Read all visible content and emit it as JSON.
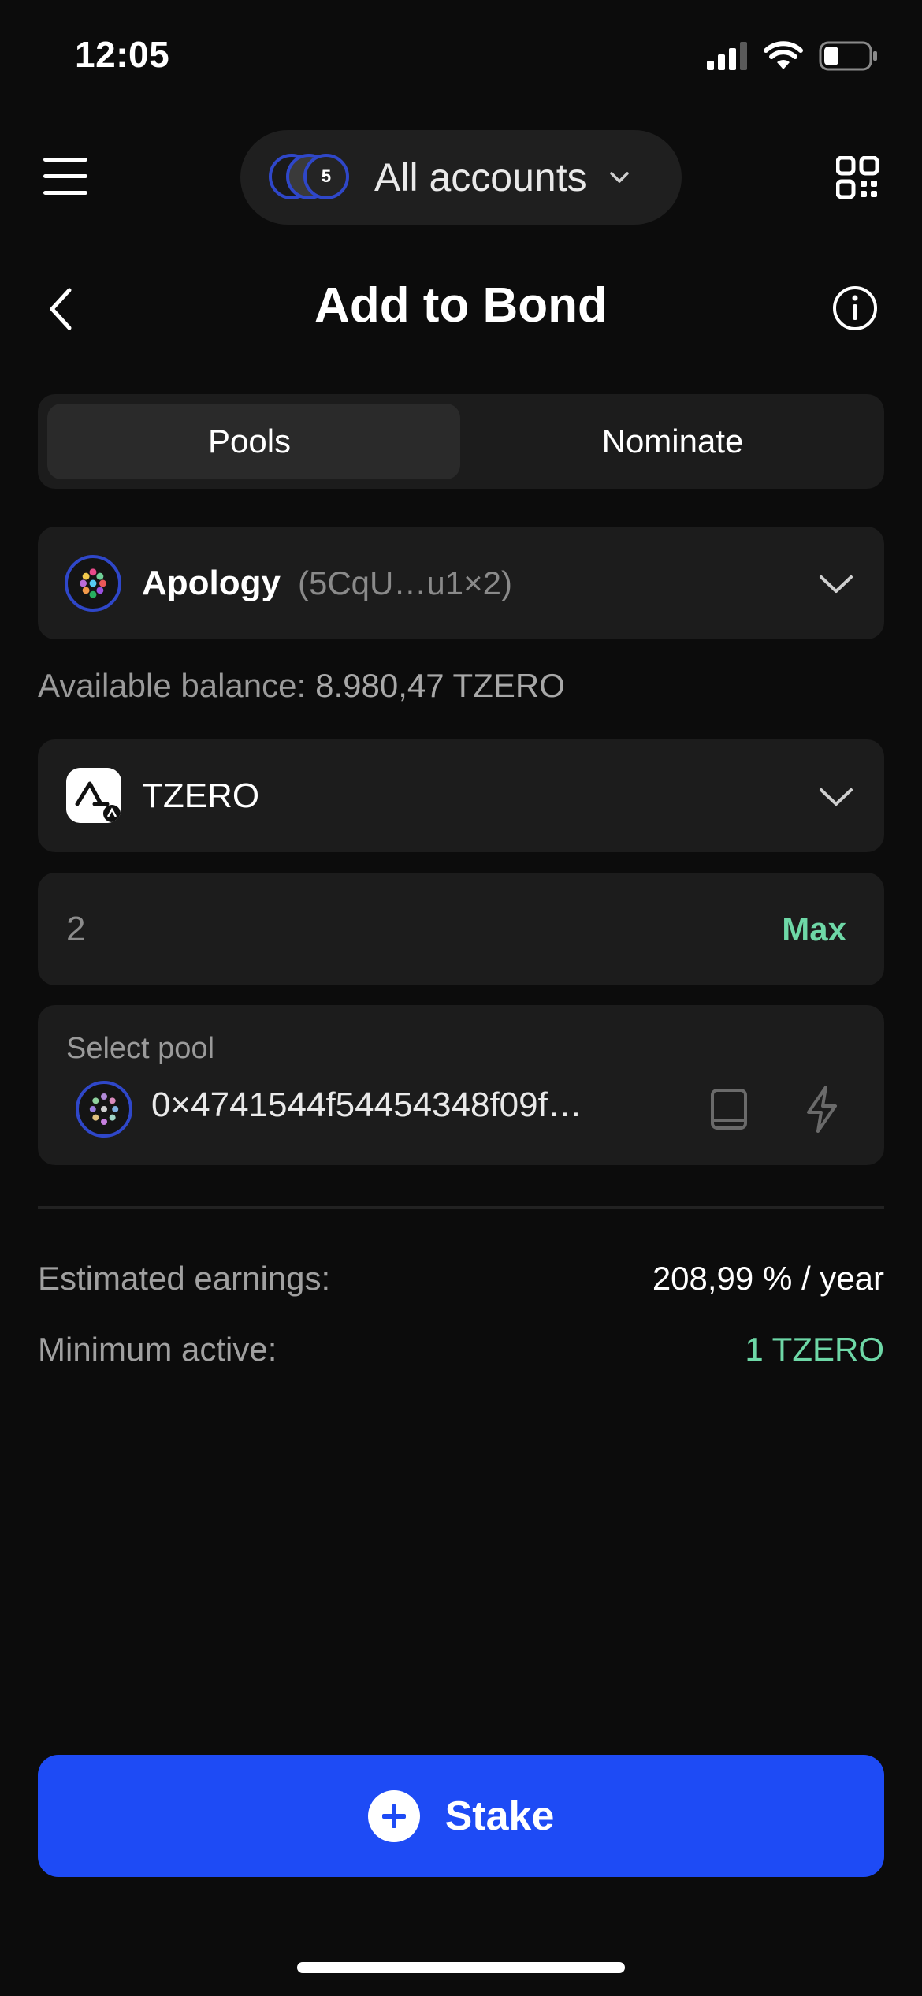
{
  "status_bar": {
    "time": "12:05",
    "battery_level": 0.3
  },
  "header": {
    "account_selector_label": "All accounts",
    "badge_text": "5"
  },
  "page": {
    "title": "Add to Bond"
  },
  "tabs": [
    {
      "label": "Pools",
      "active": true
    },
    {
      "label": "Nominate",
      "active": false
    }
  ],
  "account": {
    "name": "Apology",
    "address_short": "(5CqU…u1×2)"
  },
  "balance": {
    "label": "Available balance:",
    "value": "8.980,47 TZERO"
  },
  "token": {
    "symbol": "TZERO"
  },
  "amount": {
    "value": "2",
    "max_label": "Max"
  },
  "pool": {
    "label": "Select pool",
    "address": "0×4741544f54454348f09f…"
  },
  "earnings": {
    "label": "Estimated earnings:",
    "value": "208,99 % / year"
  },
  "minimum": {
    "label": "Minimum active:",
    "value": "1 TZERO"
  },
  "stake_button": {
    "label": "Stake"
  },
  "colors": {
    "accent_blue": "#1e4bf5",
    "accent_green": "#6ed8a7",
    "background": "#0c0c0c",
    "surface": "#1c1c1c"
  }
}
